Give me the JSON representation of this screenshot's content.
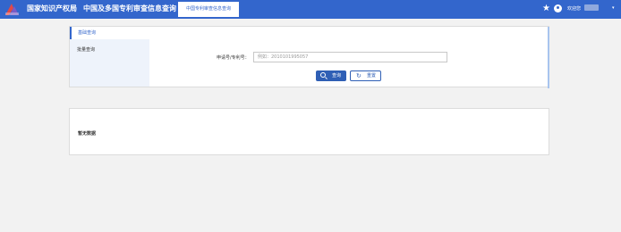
{
  "header": {
    "brand": "国家知识产权局",
    "subtitle": "中国及多国专利审查信息查询",
    "active_tab": "中国专利审查信息查询",
    "welcome": "欢迎您",
    "caret": "▾",
    "star": "★"
  },
  "colors": {
    "primary": "#3366cc",
    "button": "#2f5fb5"
  },
  "sidebar": {
    "items": [
      {
        "label": "基础查询",
        "active": true
      },
      {
        "label": "批量查询",
        "active": false
      }
    ]
  },
  "form": {
    "label": "申请号/专利号：",
    "placeholder": "例如：2010101995057"
  },
  "buttons": {
    "query": "查询",
    "reset": "重置",
    "reset_icon": "↻"
  },
  "results": {
    "empty": "暂无数据"
  }
}
